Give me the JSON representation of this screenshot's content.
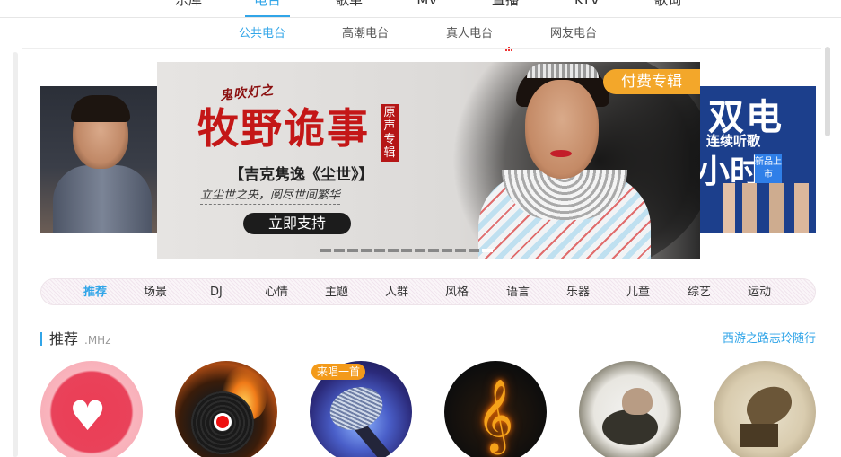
{
  "top_nav": {
    "items": [
      "乐库",
      "电台",
      "歌单",
      "MV",
      "直播",
      "KTV",
      "歌词"
    ],
    "active": "电台"
  },
  "sub_nav": {
    "items": [
      "公共电台",
      "高潮电台",
      "真人电台",
      "网友电台"
    ],
    "active": "公共电台"
  },
  "banner": {
    "small_title": "鬼吹灯之",
    "title": "牧野诡事",
    "seal": "原声专辑",
    "subtitle": "【吉克隽逸《尘世》】",
    "line": "立尘世之央，阅尽世间繁华",
    "cta_label": "立即支持",
    "badge": "付费专辑",
    "slide_count": 13,
    "active_slide": 12,
    "right_big": "双电",
    "right_mid": "连续听歌",
    "right_big2": "小时",
    "right_tag": "新品上市"
  },
  "categories": {
    "items": [
      "推荐",
      "场景",
      "DJ",
      "心情",
      "主题",
      "人群",
      "风格",
      "语言",
      "乐器",
      "儿童",
      "综艺",
      "运动"
    ],
    "active": "推荐"
  },
  "section": {
    "title": "推荐",
    "subtitle": ".MHz",
    "link": "西游之路志玲随行"
  },
  "radio_cards": {
    "tag_on_third": "来唱一首",
    "count": 6
  },
  "colors": {
    "accent": "#31a5e8",
    "badge_orange": "#f3a72a",
    "banner_red": "#c41717"
  }
}
